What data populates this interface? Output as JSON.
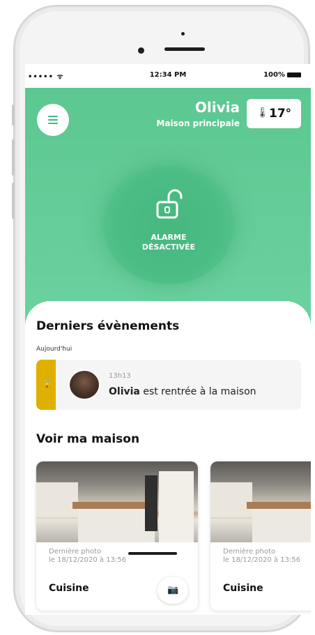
{
  "status_bar": {
    "signal": "••••• ᯤ",
    "time": "12:34 PM",
    "battery": "100%"
  },
  "header": {
    "user_name": "Olivia",
    "home_name": "Maison principale",
    "temperature": "17°"
  },
  "alarm": {
    "line1": "ALARME",
    "line2": "DÉSACTIVÉE",
    "state": "disarmed"
  },
  "events": {
    "title": "Derniers évènements",
    "day_label": "Aujourd'hui",
    "items": [
      {
        "time": "13h13",
        "name": "Olivia",
        "text": " est rentrée à la maison",
        "accent": "#e0b000"
      }
    ]
  },
  "house": {
    "title": "Voir ma maison",
    "cards": [
      {
        "caption_line1": "Dernière photo",
        "caption_line2": "le 18/12/2020 à 13:56",
        "room": "Cuisine"
      },
      {
        "caption_line1": "Dernière photo",
        "caption_line2": "le 18/12/2020 à 13:56",
        "room": "Cuisine"
      }
    ]
  },
  "colors": {
    "primary_green": "#5cc791",
    "accent_yellow": "#e0b000"
  }
}
